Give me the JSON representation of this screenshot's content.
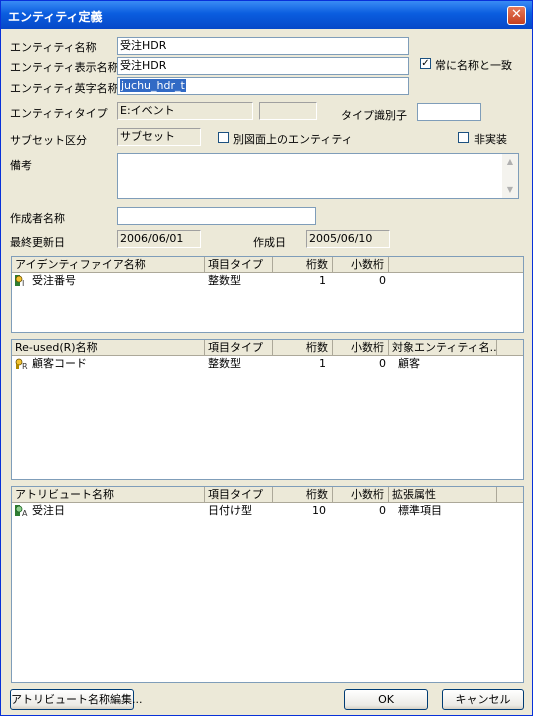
{
  "window": {
    "title": "エンティティ定義",
    "close_glyph": "✕"
  },
  "form": {
    "entity_name_label": "エンティティ名称",
    "entity_name": "受注HDR",
    "display_name_label": "エンティティ表示名称",
    "display_name": "受注HDR",
    "match_label": "常に名称と一致",
    "match_checked": true,
    "english_name_label": "エンティティ英字名称",
    "english_name": "juchu_hdr_t",
    "type_label": "エンティティタイプ",
    "type_value": "E:イベント",
    "type_value2": "",
    "type_id_label": "タイプ識別子",
    "type_id": "",
    "subset_label": "サブセット区分",
    "subset_value": "サブセット",
    "other_diagram_label": "別図面上のエンティティ",
    "not_impl_label": "非実装",
    "notes_label": "備考",
    "notes": "",
    "author_label": "作成者名称",
    "author": "",
    "updated_label": "最終更新日",
    "updated": "2006/06/01",
    "created_label": "作成日",
    "created": "2005/06/10"
  },
  "identifier_list": {
    "headers": [
      "アイデンティファイア名称",
      "項目タイプ",
      "桁数",
      "小数桁"
    ],
    "rows": [
      {
        "name": "受注番号",
        "type": "整数型",
        "digits": "1",
        "decimals": "0"
      }
    ]
  },
  "reused_list": {
    "headers": [
      "Re-used(R)名称",
      "項目タイプ",
      "桁数",
      "小数桁",
      "対象エンティティ名..."
    ],
    "rows": [
      {
        "name": "顧客コード",
        "type": "整数型",
        "digits": "1",
        "decimals": "0",
        "target": "顧客"
      }
    ]
  },
  "attribute_list": {
    "headers": [
      "アトリビュート名称",
      "項目タイプ",
      "桁数",
      "小数桁",
      "拡張属性"
    ],
    "rows": [
      {
        "name": "受注日",
        "type": "日付け型",
        "digits": "10",
        "decimals": "0",
        "ext": "標準項目"
      }
    ]
  },
  "buttons": {
    "edit_attr": "アトリビュート名称編集...",
    "ok": "OK",
    "cancel": "キャンセル"
  }
}
